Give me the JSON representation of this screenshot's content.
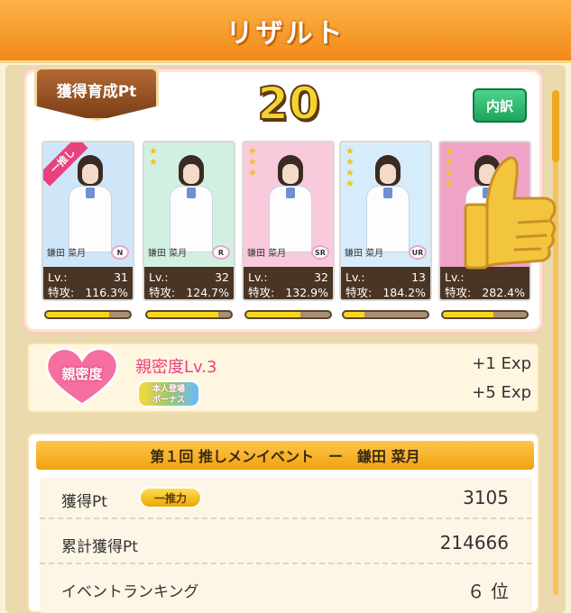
{
  "header": {
    "title": "リザルト"
  },
  "points": {
    "badge": "獲得育成Pt",
    "value": "20",
    "detail_button": "内訳"
  },
  "cards": [
    {
      "stars": "",
      "name": "鎌田 菜月",
      "rarity": "N",
      "level": "31",
      "attack": "116.3%",
      "oshi": "一推し",
      "exp": 0.75,
      "bg": "#cfe6f8"
    },
    {
      "stars": "★\n★",
      "name": "鎌田 菜月",
      "rarity": "R",
      "level": "32",
      "attack": "124.7%",
      "oshi": "",
      "exp": 0.85,
      "bg": "#d2f0e2"
    },
    {
      "stars": "★\n★\n★",
      "name": "鎌田 菜月",
      "rarity": "SR",
      "level": "32",
      "attack": "132.9%",
      "oshi": "",
      "exp": 0.65,
      "bg": "#f9c9dc"
    },
    {
      "stars": "★\n★\n★\n★",
      "name": "鎌田 菜月",
      "rarity": "UR",
      "level": "13",
      "attack": "184.2%",
      "oshi": "",
      "exp": 0.25,
      "bg": "#d7ecfb"
    },
    {
      "stars": "★\n★\n★\n★",
      "name": "",
      "rarity": "",
      "level": "",
      "attack": "282.4%",
      "oshi": "",
      "exp": 0.6,
      "bg": "#f1a3c6"
    }
  ],
  "stat_labels": {
    "level": "Lv.:",
    "attack": "特攻:"
  },
  "affinity": {
    "heart_label": "親密度",
    "title": "親密度Lv.3",
    "bonus": "本人登場\nボーナス",
    "exp1": "+1 Exp",
    "exp2": "+5 Exp"
  },
  "event": {
    "header": "第１回 推しメンイベント　ー　鎌田 菜月",
    "rows": [
      {
        "label": "獲得Pt",
        "badge": "一推力",
        "value": "3105"
      },
      {
        "label": "累計獲得Pt",
        "badge": "",
        "value": "214666"
      },
      {
        "label": "イベントランキング",
        "badge": "",
        "value": "６ 位"
      }
    ]
  },
  "colors": {
    "header": "#f08a1a",
    "accent_pink": "#e8417f",
    "stat_bg": "#4a3423",
    "exp_fill": "#f5d81b"
  }
}
